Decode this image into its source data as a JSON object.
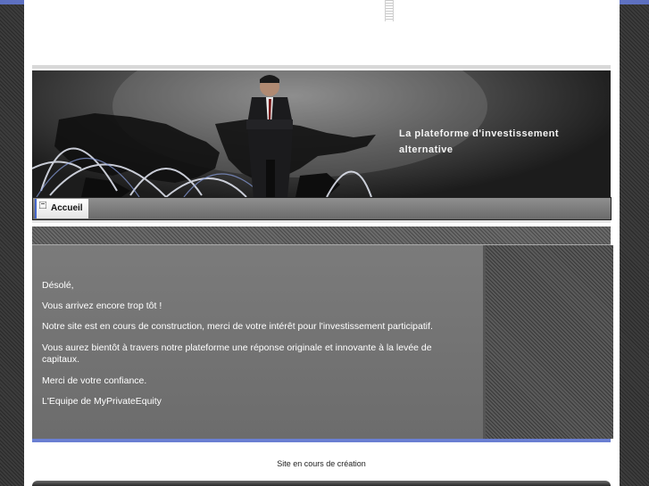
{
  "banner": {
    "tagline": "La plateforme d'investissement alternative"
  },
  "nav": {
    "items": [
      {
        "label": "Accueil"
      }
    ]
  },
  "content": {
    "paragraphs": [
      "Désolé,",
      "Vous arrivez encore trop tôt !",
      "Notre site est en cours de construction, merci de votre intérêt pour l'investissement participatif.",
      "Vous aurez bientôt à travers notre plateforme une réponse originale et innovante à la levée de capitaux.",
      "Merci de votre confiance.",
      "L'Equipe de MyPrivateEquity"
    ]
  },
  "footer": {
    "text": "Site en cours de création"
  },
  "colors": {
    "accent_blue": "#6a7fd2",
    "content_bg": "#737373"
  }
}
